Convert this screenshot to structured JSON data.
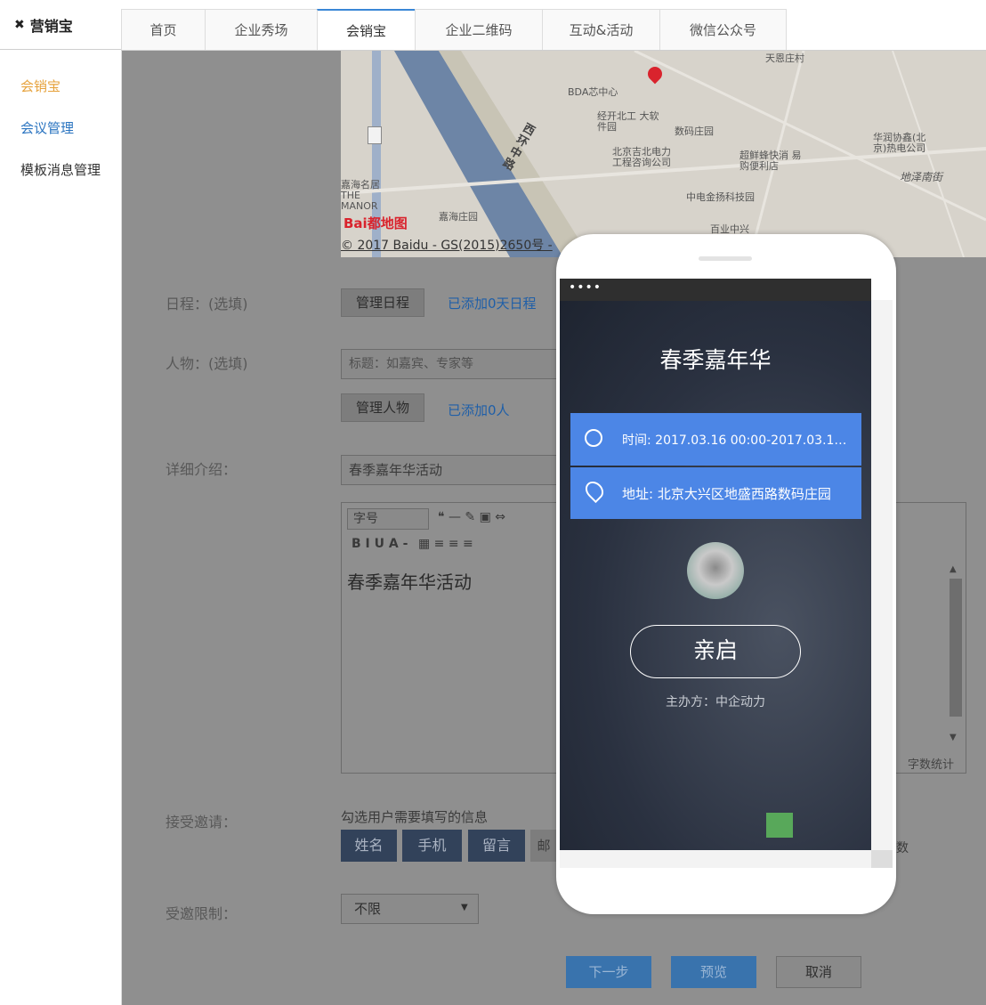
{
  "brand": {
    "logo_icon": "butterfly-logo-icon",
    "name": "营销宝"
  },
  "tabs": [
    {
      "label": "首页"
    },
    {
      "label": "企业秀场"
    },
    {
      "label": "会销宝"
    },
    {
      "label": "企业二维码"
    },
    {
      "label": "互动&活动"
    },
    {
      "label": "微信公众号"
    }
  ],
  "sidebar": {
    "items": [
      {
        "label": "会销宝",
        "color": "#e6a23c"
      },
      {
        "label": "会议管理",
        "color": "#2a74c0"
      },
      {
        "label": "模板消息管理",
        "color": "#333333"
      }
    ]
  },
  "map": {
    "places": [
      "BDA芯中心",
      "经开北工 大软件园",
      "数码庄园",
      "北京吉北电力 工程咨询公司",
      "超鲜蜂快消 易购便利店",
      "中电金扬科技园",
      "百业中兴",
      "华润协鑫(北 京)热电公司",
      "地泽南街",
      "嘉海名居THE MANOR",
      "嘉海庄园",
      "天恩庄村",
      "西环中路"
    ],
    "logo": "Bai都地图",
    "copyright": "© 2017 Baidu - GS(2015)2650号 - "
  },
  "form": {
    "schedule": {
      "label": "日程：(选填)",
      "button": "管理日程",
      "link": "已添加0天日程"
    },
    "people": {
      "label": "人物：(选填)",
      "placeholder": "标题：如嘉宾、专家等",
      "button": "管理人物",
      "link": "已添加0人"
    },
    "detail": {
      "label": "详细介绍：",
      "title_value": "春季嘉年华活动",
      "toolbar": {
        "font_size": "字号",
        "row2": "B  I  U  A -"
      },
      "content": "春季嘉年华活动",
      "word_count": "字数统计"
    },
    "invite": {
      "label": "接受邀请：",
      "hint": "勾选用户需要填写的信息",
      "options": [
        "姓名",
        "手机",
        "留言"
      ],
      "partial_option": "邮",
      "partial_right": "数"
    },
    "limit": {
      "label": "受邀限制：",
      "value": "不限"
    }
  },
  "actions": {
    "next": "下一步",
    "preview": "预览",
    "cancel": "取消"
  },
  "phone": {
    "status_dots": "••••",
    "title": "春季嘉年华",
    "time_label": "时间: 2017.03.16 00:00-2017.03.1…",
    "address_label": "地址: 北京大兴区地盛西路数码庄园",
    "open_button": "亲启",
    "organizer": "主办方：中企动力"
  },
  "colors": {
    "accent_blue": "#3a87d6",
    "phone_blue": "#4c86e6",
    "sidebar_active": "#e6a23c"
  }
}
